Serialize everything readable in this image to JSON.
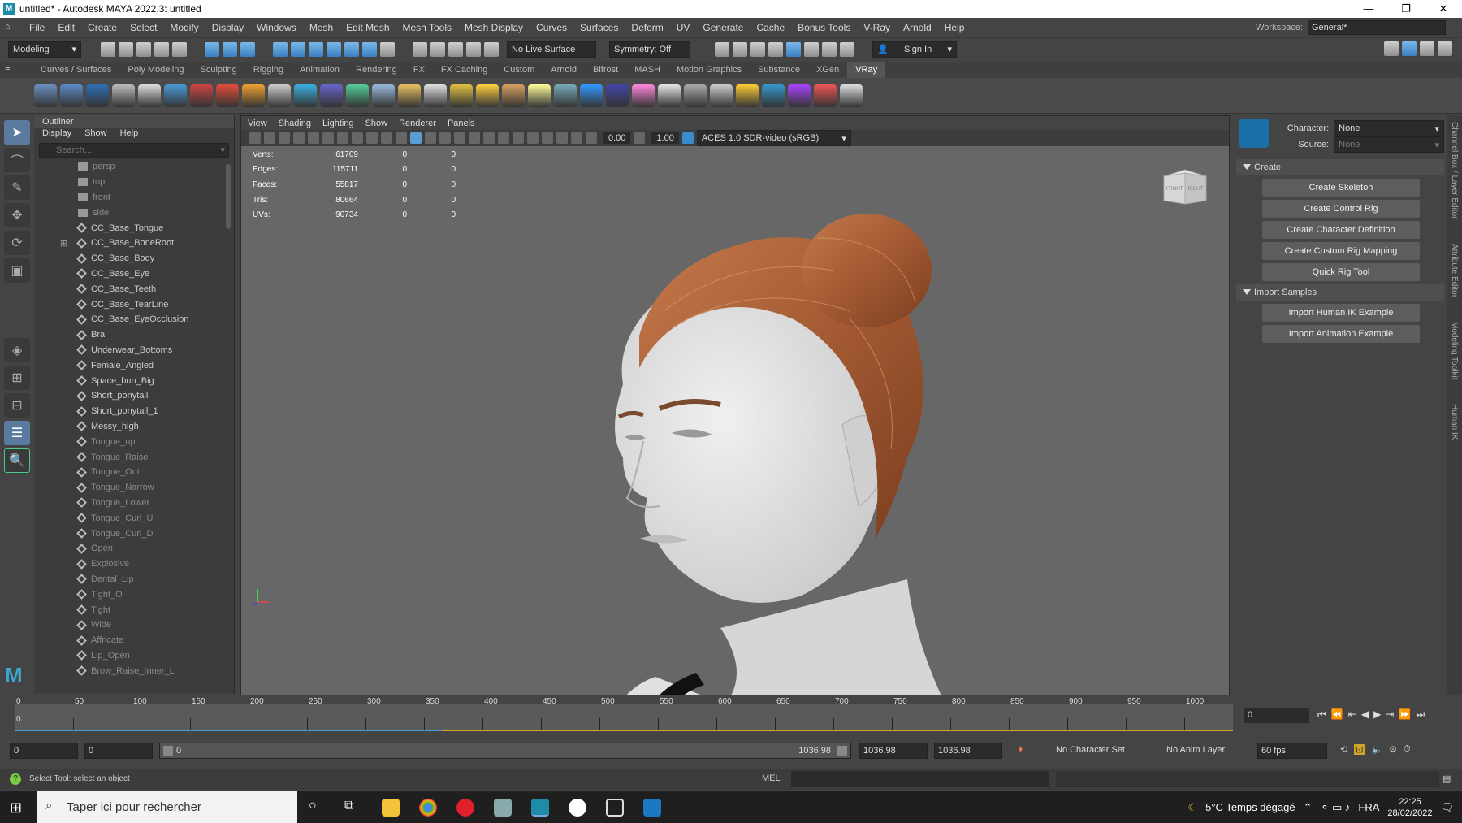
{
  "title": "untitled* - Autodesk MAYA 2022.3: untitled",
  "menu": [
    "File",
    "Edit",
    "Create",
    "Select",
    "Modify",
    "Display",
    "Windows",
    "Mesh",
    "Edit Mesh",
    "Mesh Tools",
    "Mesh Display",
    "Curves",
    "Surfaces",
    "Deform",
    "UV",
    "Generate",
    "Cache",
    "Bonus Tools",
    "V-Ray",
    "Arnold",
    "Help"
  ],
  "workspace": {
    "label": "Workspace:",
    "value": "General*"
  },
  "statusline": {
    "mode": "Modeling",
    "live_surface": "No Live Surface",
    "symmetry": "Symmetry: Off",
    "sign_in": "Sign In"
  },
  "shelf_tabs": [
    "Curves / Surfaces",
    "Poly Modeling",
    "Sculpting",
    "Rigging",
    "Animation",
    "Rendering",
    "FX",
    "FX Caching",
    "Custom",
    "Arnold",
    "Bifrost",
    "MASH",
    "Motion Graphics",
    "Substance",
    "XGen",
    "VRay"
  ],
  "active_shelf": "VRay",
  "outliner": {
    "title": "Outliner",
    "menu": [
      "Display",
      "Show",
      "Help"
    ],
    "search_placeholder": "Search...",
    "items": [
      {
        "name": "persp",
        "type": "cam",
        "dim": true
      },
      {
        "name": "top",
        "type": "cam",
        "dim": true
      },
      {
        "name": "front",
        "type": "cam",
        "dim": true
      },
      {
        "name": "side",
        "type": "cam",
        "dim": true
      },
      {
        "name": "CC_Base_Tongue",
        "type": "mesh",
        "dim": false
      },
      {
        "name": "CC_Base_BoneRoot",
        "type": "mesh",
        "dim": false
      },
      {
        "name": "CC_Base_Body",
        "type": "mesh",
        "dim": false
      },
      {
        "name": "CC_Base_Eye",
        "type": "mesh",
        "dim": false
      },
      {
        "name": "CC_Base_Teeth",
        "type": "mesh",
        "dim": false
      },
      {
        "name": "CC_Base_TearLine",
        "type": "mesh",
        "dim": false
      },
      {
        "name": "CC_Base_EyeOcclusion",
        "type": "mesh",
        "dim": false
      },
      {
        "name": "Bra",
        "type": "mesh",
        "dim": false
      },
      {
        "name": "Underwear_Bottoms",
        "type": "mesh",
        "dim": false
      },
      {
        "name": "Female_Angled",
        "type": "mesh",
        "dim": false
      },
      {
        "name": "Space_bun_Big",
        "type": "mesh",
        "dim": false
      },
      {
        "name": "Short_ponytail",
        "type": "mesh",
        "dim": false
      },
      {
        "name": "Short_ponytail_1",
        "type": "mesh",
        "dim": false
      },
      {
        "name": "Messy_high",
        "type": "mesh",
        "dim": false
      },
      {
        "name": "Tongue_up",
        "type": "mesh",
        "dim": true
      },
      {
        "name": "Tongue_Raise",
        "type": "mesh",
        "dim": true
      },
      {
        "name": "Tongue_Out",
        "type": "mesh",
        "dim": true
      },
      {
        "name": "Tongue_Narrow",
        "type": "mesh",
        "dim": true
      },
      {
        "name": "Tongue_Lower",
        "type": "mesh",
        "dim": true
      },
      {
        "name": "Tongue_Curl_U",
        "type": "mesh",
        "dim": true
      },
      {
        "name": "Tongue_Curl_D",
        "type": "mesh",
        "dim": true
      },
      {
        "name": "Open",
        "type": "mesh",
        "dim": true
      },
      {
        "name": "Explosive",
        "type": "mesh",
        "dim": true
      },
      {
        "name": "Dental_Lip",
        "type": "mesh",
        "dim": true
      },
      {
        "name": "Tight_O",
        "type": "mesh",
        "dim": true
      },
      {
        "name": "Tight",
        "type": "mesh",
        "dim": true
      },
      {
        "name": "Wide",
        "type": "mesh",
        "dim": true
      },
      {
        "name": "Affricate",
        "type": "mesh",
        "dim": true
      },
      {
        "name": "Lip_Open",
        "type": "mesh",
        "dim": true
      },
      {
        "name": "Brow_Raise_Inner_L",
        "type": "mesh",
        "dim": true
      }
    ]
  },
  "viewport": {
    "menu": [
      "View",
      "Shading",
      "Lighting",
      "Show",
      "Renderer",
      "Panels"
    ],
    "exposure": "0.00",
    "gamma": "1.00",
    "color_space": "ACES 1.0 SDR-video (sRGB)",
    "hud": [
      {
        "label": "Verts:",
        "v": "61709",
        "a": "0",
        "b": "0"
      },
      {
        "label": "Edges:",
        "v": "115711",
        "a": "0",
        "b": "0"
      },
      {
        "label": "Faces:",
        "v": "55817",
        "a": "0",
        "b": "0"
      },
      {
        "label": "Tris:",
        "v": "80664",
        "a": "0",
        "b": "0"
      },
      {
        "label": "UVs:",
        "v": "90734",
        "a": "0",
        "b": "0"
      }
    ],
    "viewcube": {
      "front": "FRONT",
      "right": "RIGHT"
    }
  },
  "hik": {
    "character_label": "Character:",
    "character_value": "None",
    "source_label": "Source:",
    "source_value": "None",
    "create_section": "Create",
    "create_buttons": [
      "Create Skeleton",
      "Create Control Rig",
      "Create Character Definition",
      "Create Custom Rig Mapping",
      "Quick Rig Tool"
    ],
    "import_section": "Import Samples",
    "import_buttons": [
      "Import Human IK Example",
      "Import Animation Example"
    ]
  },
  "side_tabs": [
    "Channel Box / Layer Editor",
    "Attribute Editor",
    "Modeling Toolkit",
    "Human IK"
  ],
  "timeline": {
    "ticks": [
      "0",
      "50",
      "100",
      "150",
      "200",
      "250",
      "300",
      "350",
      "400",
      "450",
      "500",
      "550",
      "600",
      "650",
      "700",
      "750",
      "800",
      "850",
      "900",
      "950",
      "1000"
    ],
    "current_frame": "0",
    "start_marker": "0"
  },
  "range": {
    "start": "0",
    "playback_start": "0",
    "slider_start": "0",
    "slider_end": "1036.98",
    "playback_end": "1036.98",
    "end": "1036.98",
    "character_set": "No Character Set",
    "anim_layer": "No Anim Layer",
    "fps": "60 fps"
  },
  "help_line": "Select Tool: select an object",
  "cmd_language": "MEL",
  "taskbar": {
    "search": "Taper ici pour rechercher",
    "weather": "5°C  Temps dégagé",
    "lang": "FRA",
    "time": "22:25",
    "date": "28/02/2022"
  },
  "colors": {
    "accent": "#5a7aa0",
    "hair": "#b0643a",
    "skin": "#e8e8e8"
  }
}
